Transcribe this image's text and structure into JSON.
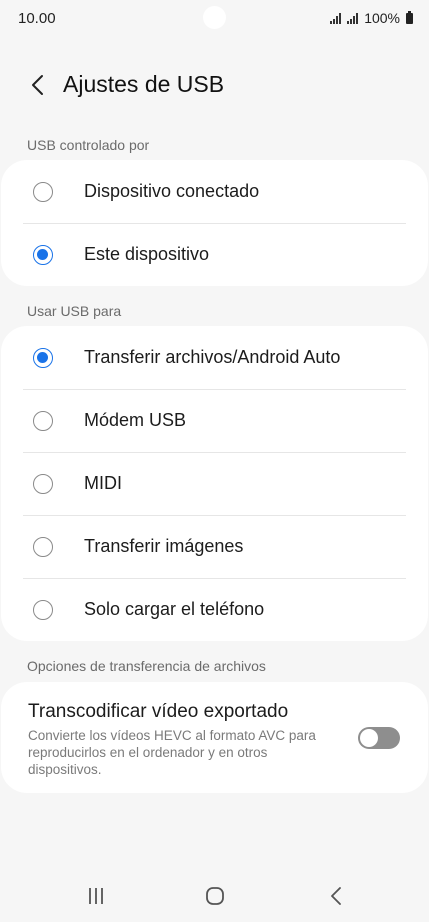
{
  "status_bar": {
    "time": "10.00",
    "battery": "100%"
  },
  "header": {
    "title": "Ajustes de USB"
  },
  "usb_controlled_by": {
    "label": "USB controlado por",
    "options": [
      {
        "label": "Dispositivo conectado",
        "selected": false
      },
      {
        "label": "Este dispositivo",
        "selected": true
      }
    ]
  },
  "use_usb_for": {
    "label": "Usar USB para",
    "options": [
      {
        "label": "Transferir archivos/Android Auto",
        "selected": true
      },
      {
        "label": "Módem USB",
        "selected": false
      },
      {
        "label": "MIDI",
        "selected": false
      },
      {
        "label": "Transferir imágenes",
        "selected": false
      },
      {
        "label": "Solo cargar el teléfono",
        "selected": false
      }
    ]
  },
  "file_transfer_options": {
    "label": "Opciones de transferencia de archivos",
    "transcode": {
      "title": "Transcodificar vídeo exportado",
      "description": "Convierte los vídeos HEVC al formato AVC para reproducirlos en el ordenador y en otros dispositivos.",
      "enabled": false
    }
  },
  "colors": {
    "accent": "#1a73e8",
    "background": "#f6f6f6",
    "card": "#ffffff"
  }
}
